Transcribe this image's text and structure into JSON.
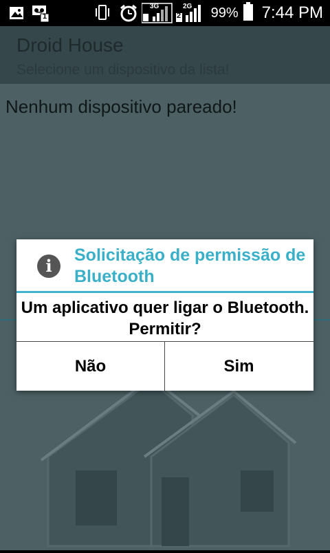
{
  "status_bar": {
    "battery_percent": "99%",
    "clock": "7:44 PM",
    "sim1_network": "3G",
    "sim2_network": "2G",
    "sim1_slot": "1",
    "sim2_slot": "2",
    "icons": [
      "gallery-icon",
      "voicemail-icon",
      "vibrate-icon",
      "alarm-icon",
      "signal-sim1-icon",
      "signal-sim2-icon",
      "battery-icon"
    ]
  },
  "app": {
    "title": "Droid House",
    "subtitle": "Selecione um dispositivo da lista!",
    "empty_message": "Nenhum dispositivo pareado!"
  },
  "dialog": {
    "icon": "info-icon",
    "title": "Solicitação de permissão de Bluetooth",
    "message": "Um aplicativo quer ligar o Bluetooth. Permitir?",
    "negative_label": "Não",
    "positive_label": "Sim"
  },
  "colors": {
    "dialog_title": "#3ab0c8",
    "dialog_rule": "#40b4cc",
    "app_background": "#4d6165",
    "action_bar": "#36474b"
  }
}
